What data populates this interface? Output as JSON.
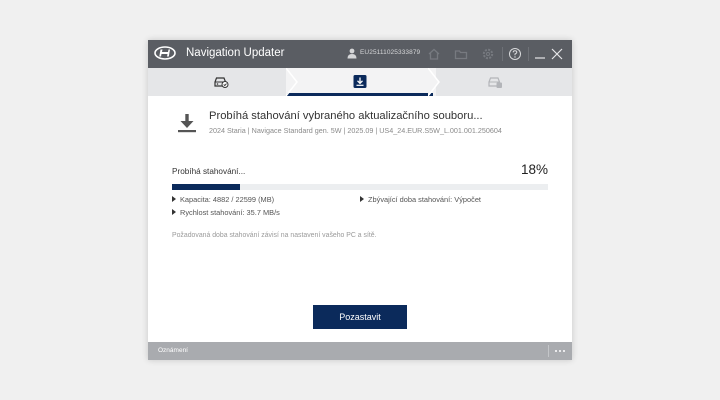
{
  "app": {
    "title": "Navigation Updater",
    "user_id": "EU25111025333879",
    "colors": {
      "titlebar": "#5a5d63",
      "accent": "#0b2a5b",
      "footer": "#a9abaf"
    }
  },
  "toolbar": {
    "icons": [
      "home-icon",
      "folder-icon",
      "settings-icon",
      "help-icon",
      "minimize-icon",
      "close-icon"
    ]
  },
  "steps": {
    "items": [
      {
        "icon": "car-search-icon",
        "state": "completed"
      },
      {
        "icon": "download-icon",
        "state": "active"
      },
      {
        "icon": "car-install-icon",
        "state": "pending"
      }
    ]
  },
  "download": {
    "heading": "Probíhá stahování vybraného aktualizačního souboru...",
    "subheading": "2024 Staria | Navigace Standard gen. 5W | 2025.09 | US4_24.EUR.S5W_L.001.001.250604",
    "status_label": "Probíhá stahování...",
    "percent_text": "18%",
    "progress": 0.18,
    "capacity": "Kapacita: 4882 / 22599 (MB)",
    "speed": "Rychlost stahování: 35.7 MB/s",
    "remaining": "Zbývající doba stahování: Výpočet",
    "note": "Požadovaná doba stahování závisí na nastavení vašeho PC a sítě."
  },
  "actions": {
    "pause_label": "Pozastavit"
  },
  "footer": {
    "label": "Oznámení",
    "more_icon": "more-dots-icon"
  }
}
